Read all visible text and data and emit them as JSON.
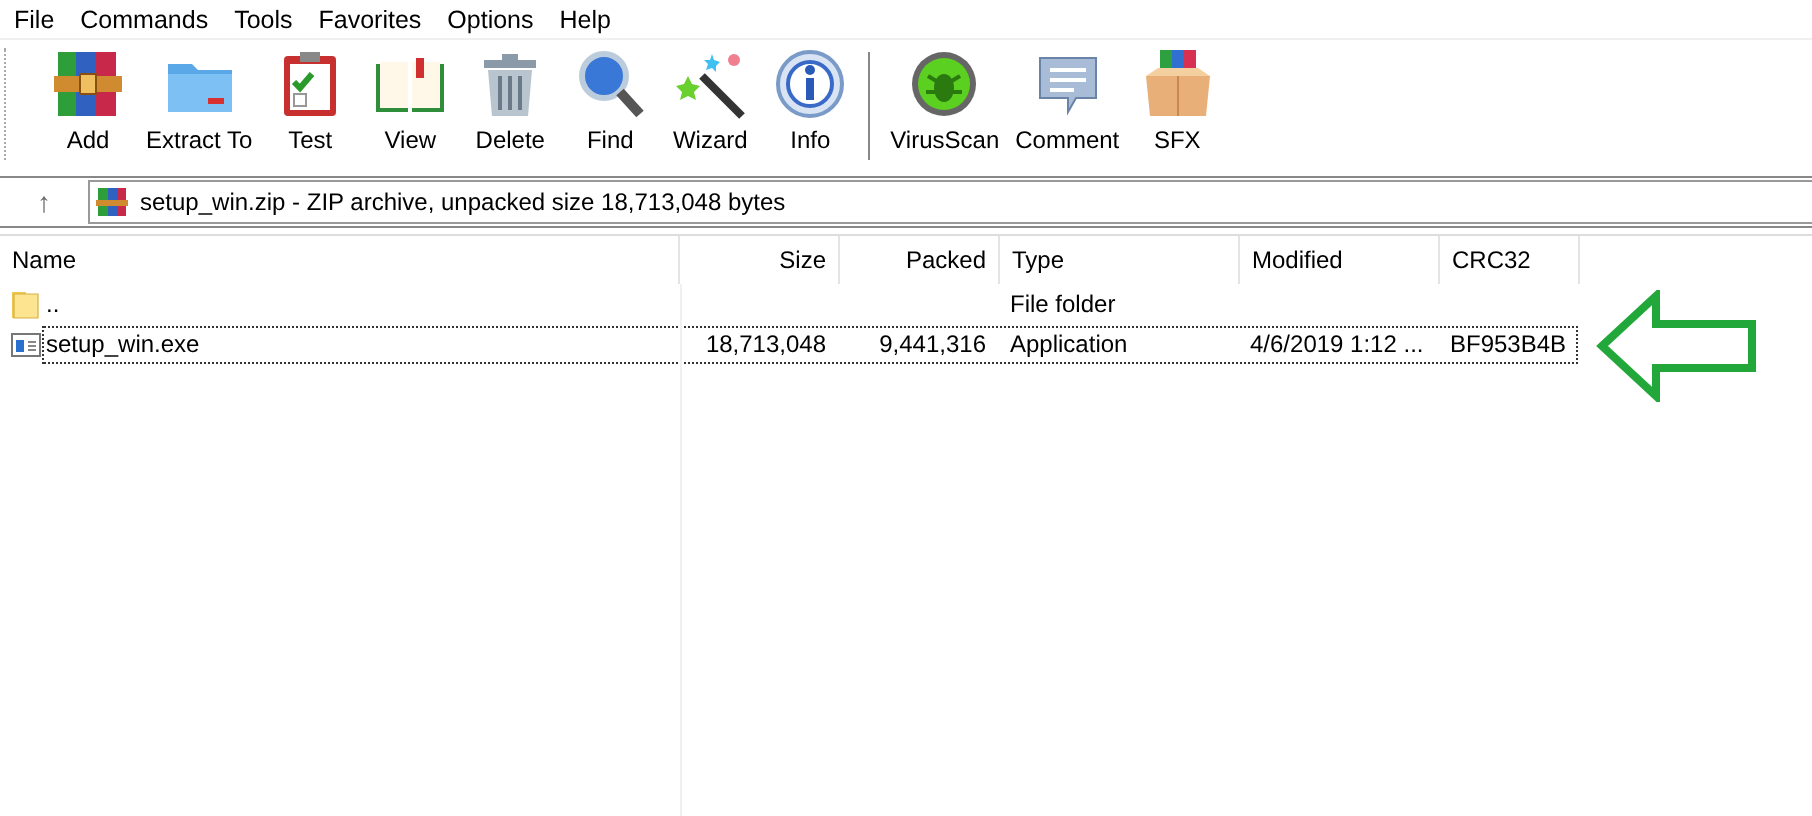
{
  "menu": [
    "File",
    "Commands",
    "Tools",
    "Favorites",
    "Options",
    "Help"
  ],
  "toolbar": [
    {
      "label": "Add",
      "kind": "books"
    },
    {
      "label": "Extract To",
      "kind": "folder"
    },
    {
      "label": "Test",
      "kind": "clipboard"
    },
    {
      "label": "View",
      "kind": "book"
    },
    {
      "label": "Delete",
      "kind": "trash"
    },
    {
      "label": "Find",
      "kind": "magnifier"
    },
    {
      "label": "Wizard",
      "kind": "wand"
    },
    {
      "label": "Info",
      "kind": "info"
    },
    {
      "label": "VirusScan",
      "kind": "bug"
    },
    {
      "label": "Comment",
      "kind": "comment"
    },
    {
      "label": "SFX",
      "kind": "box"
    }
  ],
  "address": {
    "up": "↑",
    "path": "setup_win.zip - ZIP archive, unpacked size 18,713,048 bytes"
  },
  "table": {
    "columns": [
      "Name",
      "Size",
      "Packed",
      "Type",
      "Modified",
      "CRC32"
    ],
    "rows": [
      {
        "kind": "folder",
        "selected": false,
        "cells": [
          "..",
          "",
          "",
          "File folder",
          "",
          ""
        ]
      },
      {
        "kind": "exe",
        "selected": true,
        "cells": [
          "setup_win.exe",
          "18,713,048",
          "9,441,316",
          "Application",
          "4/6/2019 1:12 ...",
          "BF953B4B"
        ]
      }
    ]
  }
}
